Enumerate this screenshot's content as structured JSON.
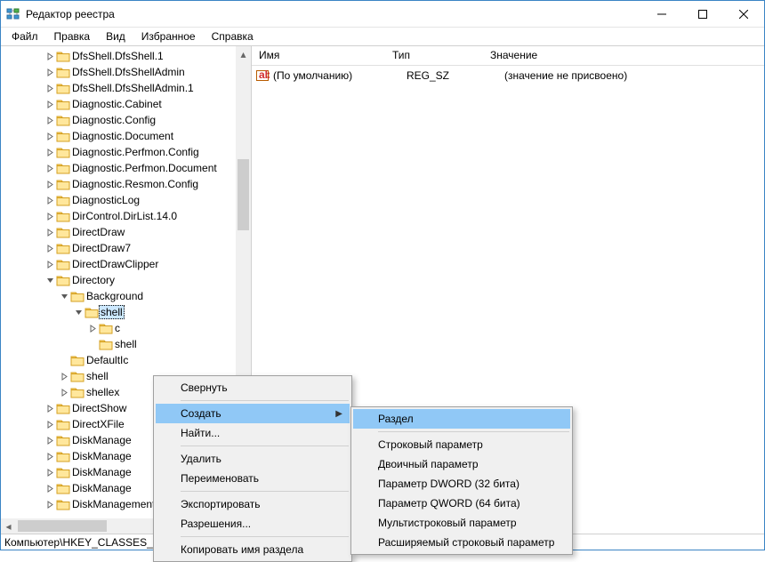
{
  "title": "Редактор реестра",
  "menu": {
    "file": "Файл",
    "edit": "Правка",
    "view": "Вид",
    "favorites": "Избранное",
    "help": "Справка"
  },
  "tree": [
    {
      "depth": 3,
      "exp": ">",
      "label": "DfsShell.DfsShell.1"
    },
    {
      "depth": 3,
      "exp": ">",
      "label": "DfsShell.DfsShellAdmin"
    },
    {
      "depth": 3,
      "exp": ">",
      "label": "DfsShell.DfsShellAdmin.1"
    },
    {
      "depth": 3,
      "exp": ">",
      "label": "Diagnostic.Cabinet"
    },
    {
      "depth": 3,
      "exp": ">",
      "label": "Diagnostic.Config"
    },
    {
      "depth": 3,
      "exp": ">",
      "label": "Diagnostic.Document"
    },
    {
      "depth": 3,
      "exp": ">",
      "label": "Diagnostic.Perfmon.Config"
    },
    {
      "depth": 3,
      "exp": ">",
      "label": "Diagnostic.Perfmon.Document"
    },
    {
      "depth": 3,
      "exp": ">",
      "label": "Diagnostic.Resmon.Config"
    },
    {
      "depth": 3,
      "exp": ">",
      "label": "DiagnosticLog"
    },
    {
      "depth": 3,
      "exp": ">",
      "label": "DirControl.DirList.14.0"
    },
    {
      "depth": 3,
      "exp": ">",
      "label": "DirectDraw"
    },
    {
      "depth": 3,
      "exp": ">",
      "label": "DirectDraw7"
    },
    {
      "depth": 3,
      "exp": ">",
      "label": "DirectDrawClipper"
    },
    {
      "depth": 3,
      "exp": "v",
      "label": "Directory"
    },
    {
      "depth": 4,
      "exp": "v",
      "label": "Background"
    },
    {
      "depth": 5,
      "exp": "v",
      "label": "shell",
      "sel": true
    },
    {
      "depth": 6,
      "exp": ">",
      "label": "c"
    },
    {
      "depth": 6,
      "exp": " ",
      "label": "shell"
    },
    {
      "depth": 4,
      "exp": " ",
      "label": "DefaultIc"
    },
    {
      "depth": 4,
      "exp": ">",
      "label": "shell"
    },
    {
      "depth": 4,
      "exp": ">",
      "label": "shellex"
    },
    {
      "depth": 3,
      "exp": ">",
      "label": "DirectShow"
    },
    {
      "depth": 3,
      "exp": ">",
      "label": "DirectXFile"
    },
    {
      "depth": 3,
      "exp": ">",
      "label": "DiskManage"
    },
    {
      "depth": 3,
      "exp": ">",
      "label": "DiskManage"
    },
    {
      "depth": 3,
      "exp": ">",
      "label": "DiskManage"
    },
    {
      "depth": 3,
      "exp": ">",
      "label": "DiskManage"
    },
    {
      "depth": 3,
      "exp": ">",
      "label": "DiskManagement.SnapInAbout"
    }
  ],
  "list": {
    "cols": {
      "name": "Имя",
      "type": "Тип",
      "value": "Значение"
    },
    "rows": [
      {
        "name": "(По умолчанию)",
        "type": "REG_SZ",
        "value": "(значение не присвоено)"
      }
    ]
  },
  "ctx_main": {
    "collapse": "Свернуть",
    "create": "Создать",
    "find": "Найти...",
    "delete": "Удалить",
    "rename": "Переименовать",
    "export": "Экспортировать",
    "perms": "Разрешения...",
    "copyname": "Копировать имя раздела"
  },
  "ctx_sub": {
    "key": "Раздел",
    "string": "Строковый параметр",
    "binary": "Двоичный параметр",
    "dword": "Параметр DWORD (32 бита)",
    "qword": "Параметр QWORD (64 бита)",
    "multisz": "Мультистроковый параметр",
    "expandsz": "Расширяемый строковый параметр"
  },
  "status": "Компьютер\\HKEY_CLASSES_ROOT\\Directory\\Background\\shell"
}
